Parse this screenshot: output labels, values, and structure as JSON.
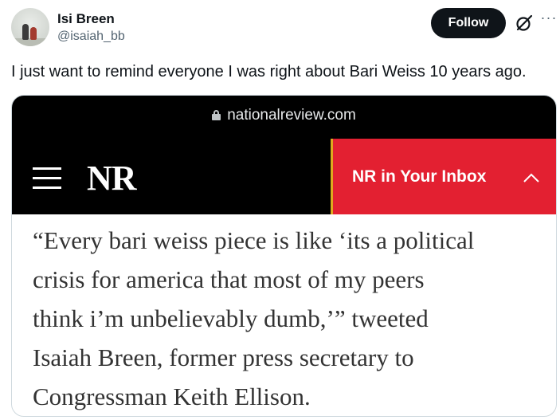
{
  "author": {
    "name": "Isi Breen",
    "handle": "@isaiah_bb"
  },
  "actions": {
    "follow_label": "Follow",
    "grok_icon": "grok-icon",
    "more_icon": "more-icon",
    "more_glyph": "···"
  },
  "tweet": {
    "text": "I just want to remind everyone I was right about Bari Weiss 10 years ago."
  },
  "media": {
    "url": "nationalreview.com",
    "logo": "NR",
    "inbox_label": "NR in Your Inbox",
    "quote_lines": [
      "“Every bari weiss piece is like ‘its a political",
      "crisis for america that most of my peers",
      "think i’m unbelievably dumb,’” tweeted",
      "Isaiah Breen, former press secretary to",
      "Congressman Keith Ellison."
    ]
  },
  "colors": {
    "brand_red": "#e32031",
    "accent_gold": "#e0a81e",
    "follow_bg": "#0f1419"
  }
}
